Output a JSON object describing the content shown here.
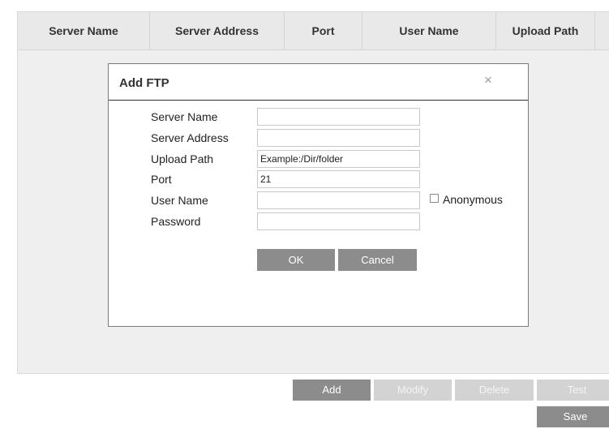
{
  "table": {
    "columns": [
      "Server Name",
      "Server Address",
      "Port",
      "User Name",
      "Upload Path"
    ]
  },
  "dialog": {
    "title": "Add FTP",
    "close_glyph": "×",
    "fields": {
      "server_name": {
        "label": "Server Name",
        "value": ""
      },
      "server_address": {
        "label": "Server Address",
        "value": ""
      },
      "upload_path": {
        "label": "Upload Path",
        "value": "Example:/Dir/folder"
      },
      "port": {
        "label": "Port",
        "value": "21"
      },
      "user_name": {
        "label": "User Name",
        "value": ""
      },
      "password": {
        "label": "Password",
        "value": ""
      }
    },
    "anonymous_label": "Anonymous",
    "anonymous_checked": false,
    "ok_label": "OK",
    "cancel_label": "Cancel"
  },
  "toolbar": {
    "add_label": "Add",
    "modify_label": "Modify",
    "delete_label": "Delete",
    "test_label": "Test",
    "save_label": "Save"
  },
  "colors": {
    "button_active": "#8c8c8c",
    "button_disabled": "#d3d3d3",
    "table_background": "#efefef"
  }
}
